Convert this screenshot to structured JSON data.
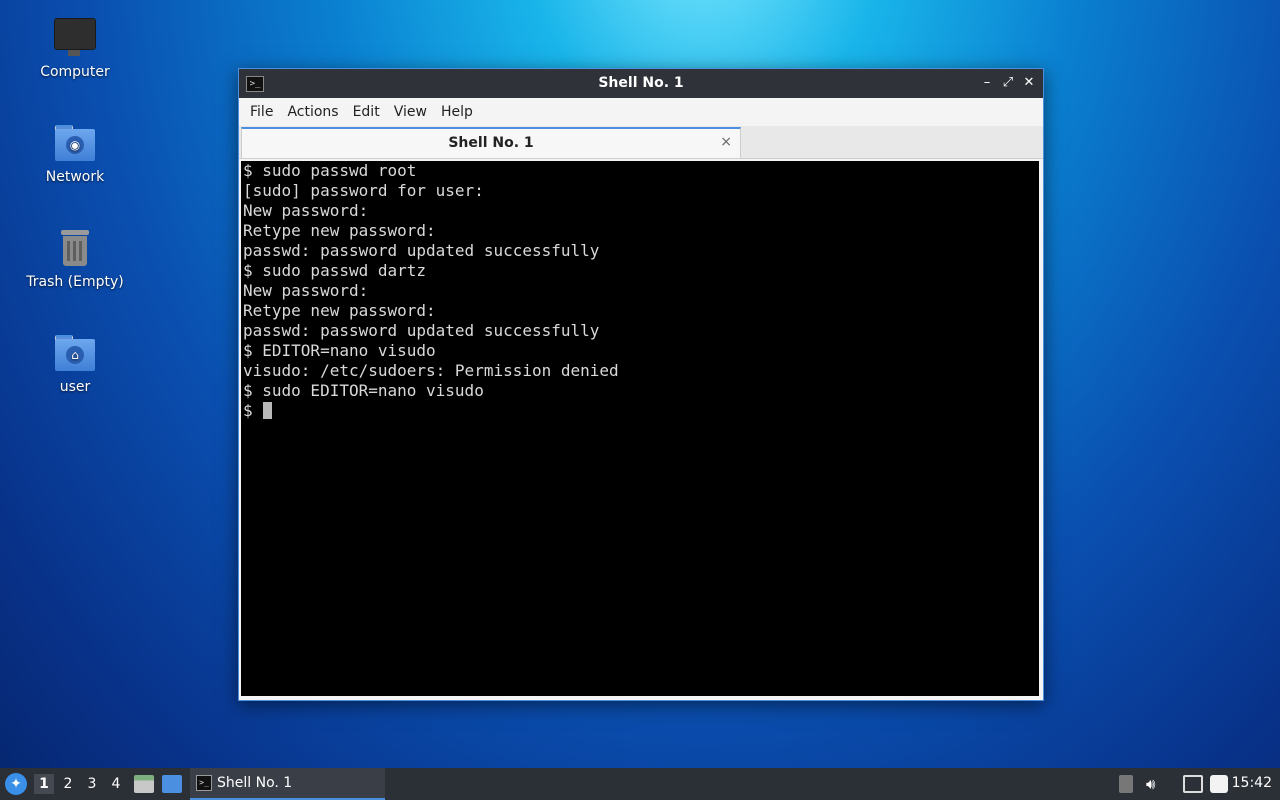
{
  "desktop": {
    "icons": [
      {
        "label": "Computer"
      },
      {
        "label": "Network"
      },
      {
        "label": "Trash (Empty)"
      },
      {
        "label": "user"
      }
    ]
  },
  "window": {
    "title": "Shell No. 1",
    "controls": {
      "minimize": "–",
      "maximize": "⤢",
      "close": "✕"
    },
    "menu": [
      "File",
      "Actions",
      "Edit",
      "View",
      "Help"
    ],
    "tab": {
      "label": "Shell No. 1",
      "close": "×"
    }
  },
  "terminal": {
    "lines": [
      "$ sudo passwd root",
      "[sudo] password for user:",
      "New password:",
      "Retype new password:",
      "passwd: password updated successfully",
      "$ sudo passwd dartz",
      "New password:",
      "Retype new password:",
      "passwd: password updated successfully",
      "$ EDITOR=nano visudo",
      "visudo: /etc/sudoers: Permission denied",
      "$ sudo EDITOR=nano visudo"
    ],
    "prompt": "$ "
  },
  "taskbar": {
    "workspaces": [
      "1",
      "2",
      "3",
      "4"
    ],
    "active_workspace": "1",
    "task": {
      "label": "Shell No. 1"
    },
    "clock": "15:42"
  },
  "colors": {
    "accent": "#4a8fe0",
    "terminal_bg": "#000000",
    "taskbar_bg": "#2b2f36"
  }
}
